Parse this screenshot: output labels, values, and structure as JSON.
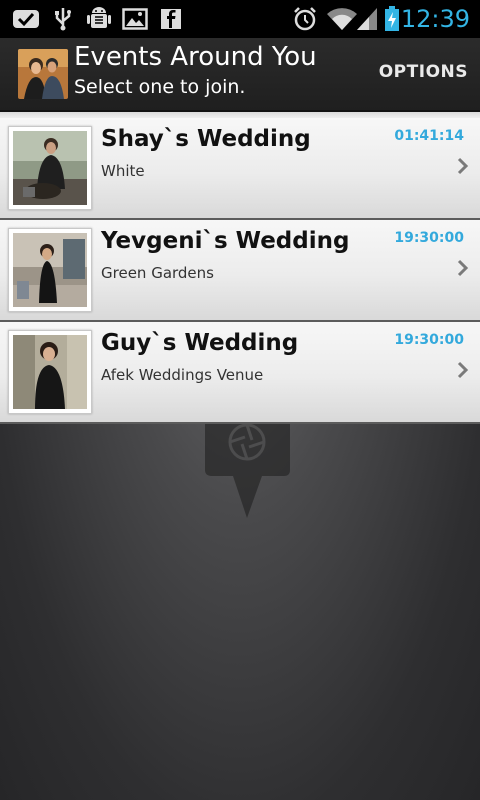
{
  "status_bar": {
    "time": "12:39",
    "icons": [
      "gmail-icon",
      "usb-icon",
      "android-debug-icon",
      "gallery-icon",
      "facebook-icon",
      "alarm-icon",
      "wifi-icon",
      "signal-icon",
      "battery-charging-icon"
    ],
    "accent": "#33b5e5"
  },
  "action_bar": {
    "title": "Events Around You",
    "subtitle": "Select one to join.",
    "options_label": "OPTIONS"
  },
  "events": [
    {
      "name": "Shay`s Wedding",
      "venue": "White",
      "time": "01:41:14"
    },
    {
      "name": "Yevgeni`s Wedding",
      "venue": "Green Gardens",
      "time": "19:30:00"
    },
    {
      "name": "Guy`s Wedding",
      "venue": "Afek Weddings Venue",
      "time": "19:30:00"
    }
  ],
  "colors": {
    "time_accent": "#33a9dc",
    "list_bg": "#eeeeee",
    "action_bar_bg": "#252525"
  }
}
